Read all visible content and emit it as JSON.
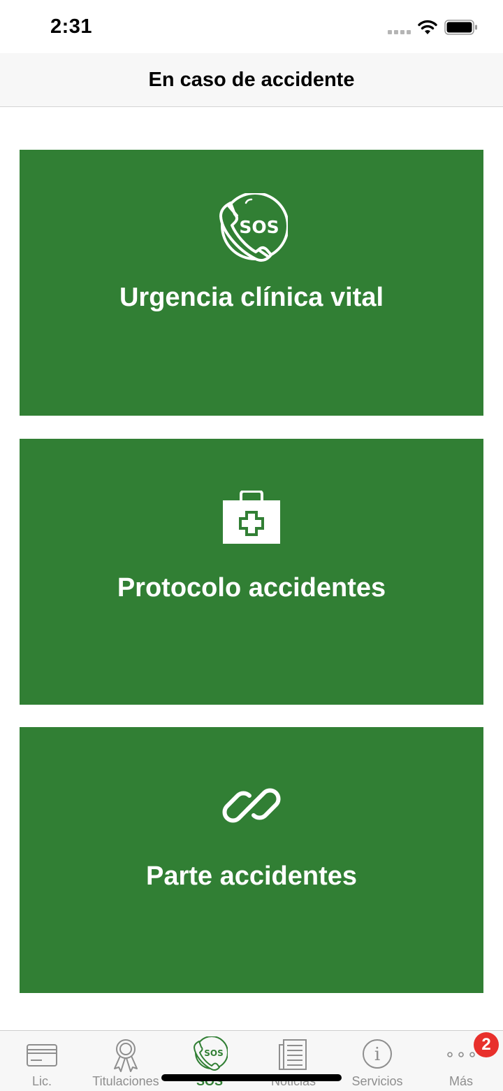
{
  "status_bar": {
    "time": "2:31"
  },
  "header": {
    "title": "En caso de accidente"
  },
  "cards": [
    {
      "label": "Urgencia clínica vital",
      "icon": "sos-phone-icon"
    },
    {
      "label": "Protocolo accidentes",
      "icon": "first-aid-kit-icon"
    },
    {
      "label": "Parte accidentes",
      "icon": "link-icon"
    }
  ],
  "tabs": [
    {
      "label": "Lic.",
      "icon": "license-card-icon",
      "active": false
    },
    {
      "label": "Titulaciones",
      "icon": "award-ribbon-icon",
      "active": false
    },
    {
      "label": "SOS",
      "icon": "sos-phone-icon",
      "active": true
    },
    {
      "label": "Noticias",
      "icon": "newspaper-icon",
      "active": false
    },
    {
      "label": "Servicios",
      "icon": "info-icon",
      "active": false
    },
    {
      "label": "Más",
      "icon": "more-dots-icon",
      "active": false
    }
  ],
  "more_badge": "2",
  "colors": {
    "accent": "#317f34",
    "tab_inactive": "#8e8e8e",
    "badge": "#e8302c"
  }
}
